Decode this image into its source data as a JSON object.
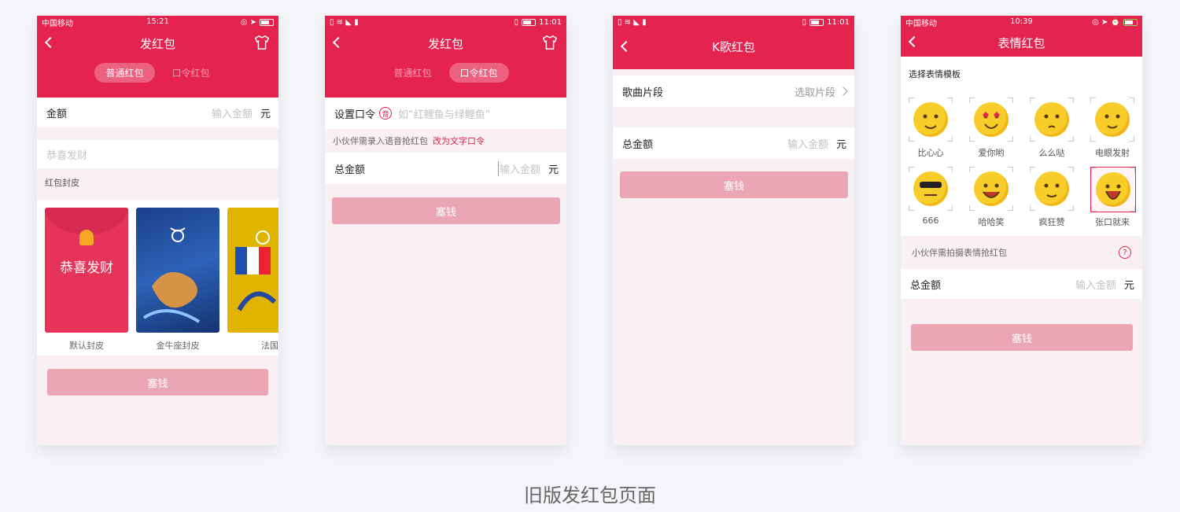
{
  "caption": "旧版发红包页面",
  "phone1": {
    "carrier": "中国移动",
    "time": "15:21",
    "title": "发红包",
    "tabs": [
      "普通红包",
      "口令红包"
    ],
    "amount_label": "金额",
    "amount_placeholder": "输入金额",
    "unit": "元",
    "greeting_placeholder": "恭喜发财",
    "cover_section": "红包封皮",
    "default_cover_text": "恭喜发财",
    "covers": [
      "默认封皮",
      "金牛座封皮",
      "法国"
    ],
    "submit": "塞钱"
  },
  "phone2": {
    "time": "11:01",
    "title": "发红包",
    "tabs": [
      "普通红包",
      "口令红包"
    ],
    "password_label": "设置口令",
    "password_badge": "音",
    "password_placeholder": "如“红鲤鱼与绿鲤鱼”",
    "hint": "小伙伴需录入语音抢红包",
    "hint_link": "改为文字口令",
    "total_label": "总金额",
    "amount_placeholder": "输入金额",
    "unit": "元",
    "submit": "塞钱"
  },
  "phone3": {
    "time": "11:01",
    "title": "K歌红包",
    "song_label": "歌曲片段",
    "song_action": "选取片段",
    "total_label": "总金额",
    "amount_placeholder": "输入金额",
    "unit": "元",
    "submit": "塞钱"
  },
  "phone4": {
    "carrier": "中国移动",
    "time": "10:39",
    "title": "表情红包",
    "template_title": "选择表情模板",
    "emojis": [
      "比心心",
      "爱你哟",
      "么么哒",
      "电眼发射",
      "666",
      "哈哈笑",
      "疯狂赞",
      "张口就来"
    ],
    "hint": "小伙伴需拍摄表情抢红包",
    "help": "?",
    "total_label": "总金额",
    "amount_placeholder": "输入金额",
    "unit": "元",
    "submit": "塞钱"
  },
  "colors": {
    "brand": "#e5234f",
    "button": "#eba6b5",
    "bg": "#f8f0f3"
  }
}
